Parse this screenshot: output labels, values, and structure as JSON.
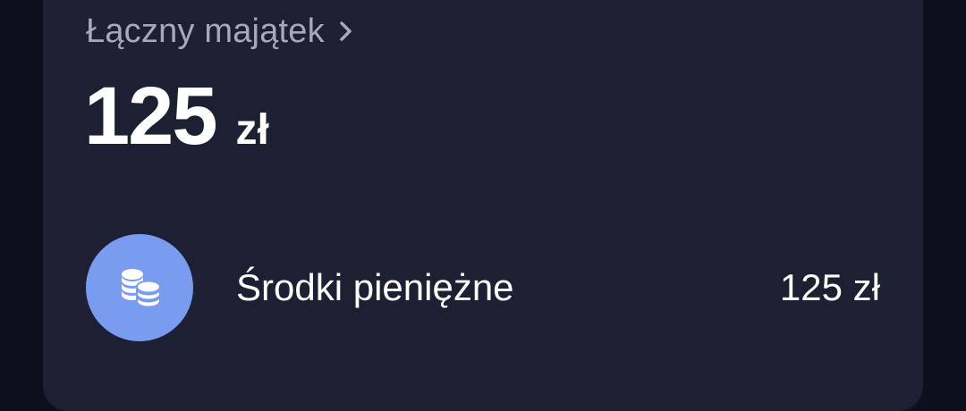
{
  "summary": {
    "title": "Łączny majątek",
    "chevron_icon": "chevron-right-icon",
    "total_amount": "125",
    "total_currency": "zł"
  },
  "assets": [
    {
      "icon": "coins-icon",
      "label": "Środki pieniężne",
      "value": "125 zł"
    }
  ],
  "colors": {
    "background": "#0d0f1c",
    "card": "#1d1f32",
    "muted_text": "#a7a9b8",
    "accent": "#7a9cf0",
    "text": "#ffffff"
  }
}
